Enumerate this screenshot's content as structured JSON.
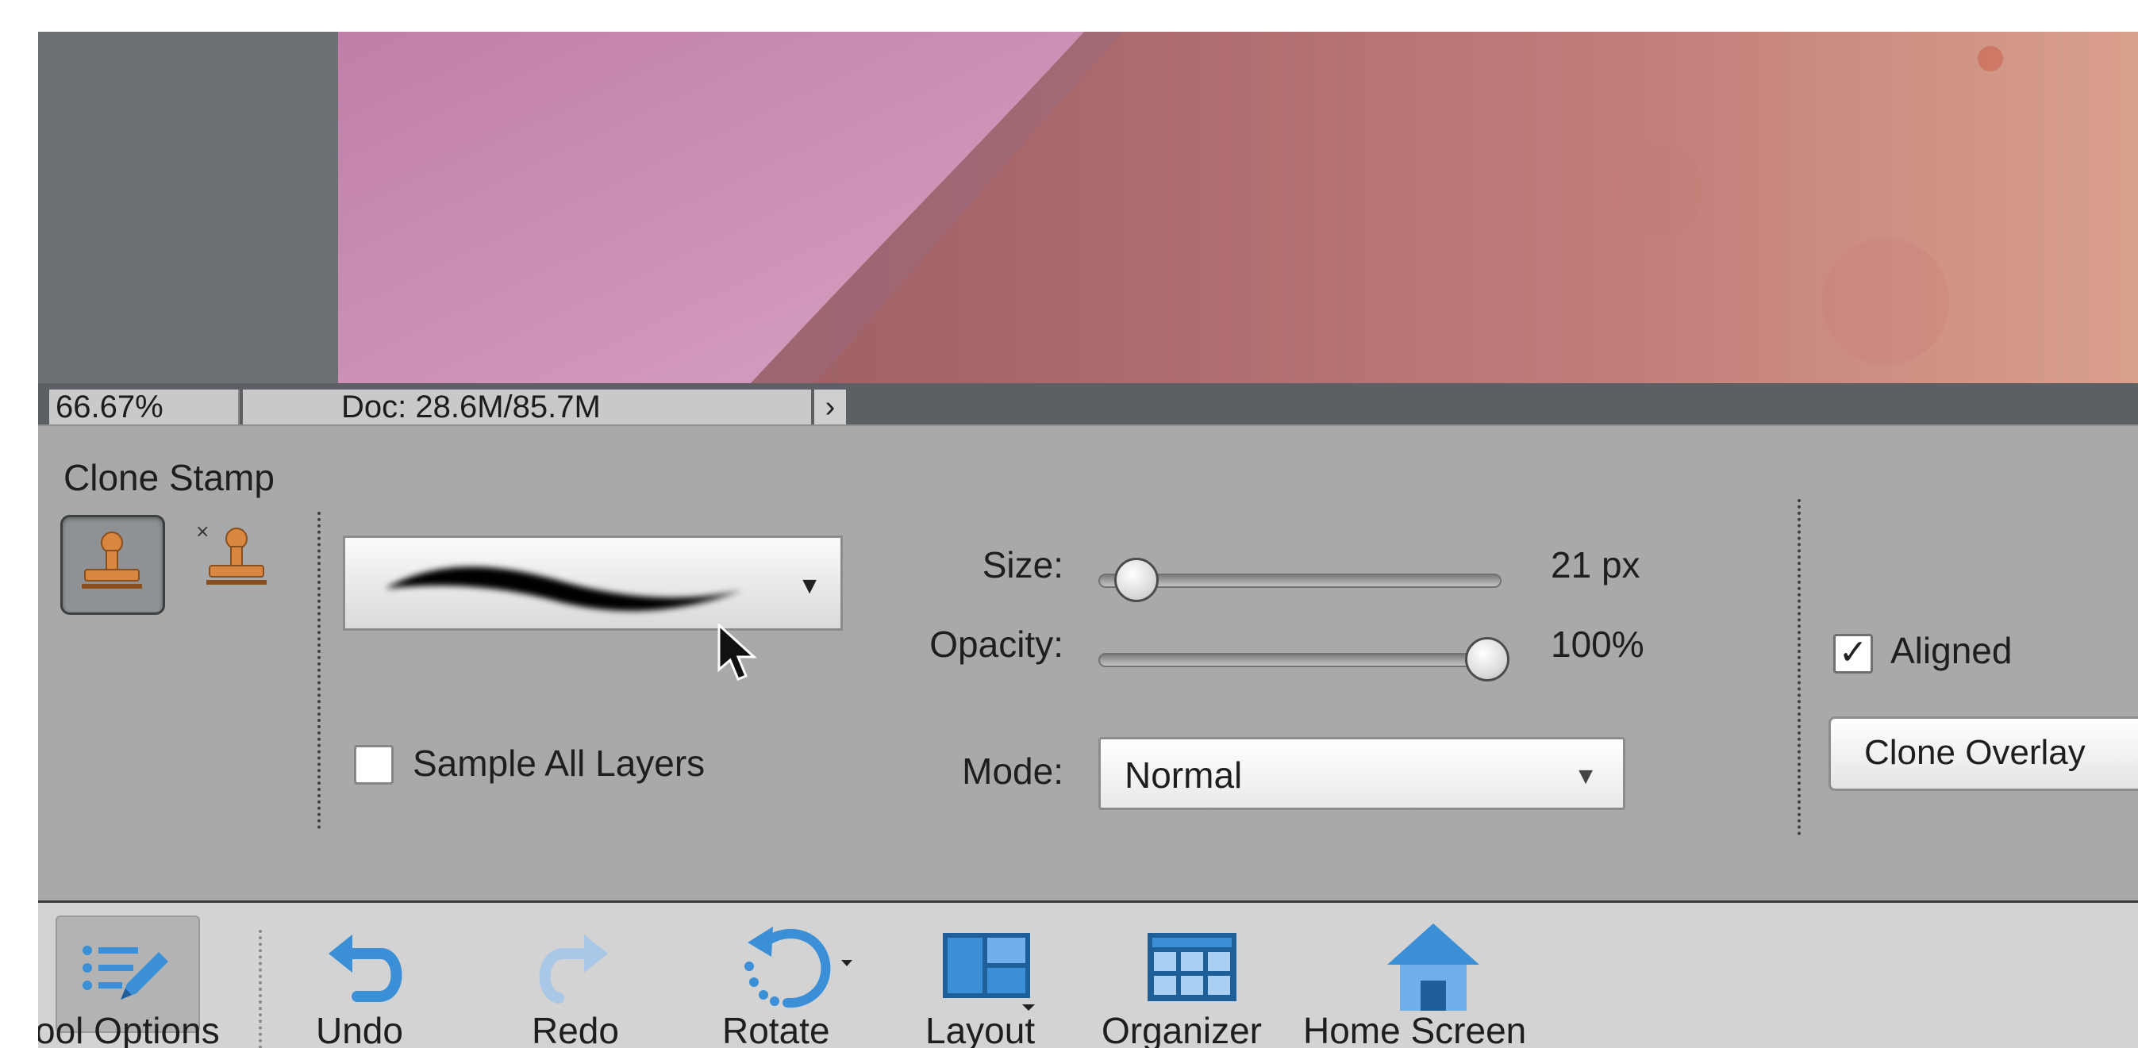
{
  "status": {
    "zoom": "66.67%",
    "doc": "Doc: 28.6M/85.7M",
    "arrow": "›"
  },
  "options": {
    "tool_title": "Clone Stamp",
    "sample_all_layers": "Sample All Layers",
    "size_label": "Size:",
    "size_value": "21 px",
    "size_fraction": 0.08,
    "opacity_label": "Opacity:",
    "opacity_value": "100%",
    "opacity_fraction": 1.0,
    "mode_label": "Mode:",
    "mode_value": "Normal",
    "aligned_label": "Aligned",
    "aligned_checked": true,
    "sample_checked": false,
    "clone_overlay": "Clone Overlay",
    "icons": [
      "clone-stamp-icon",
      "pattern-stamp-icon",
      "brush-stroke-icon",
      "dropdown-caret-icon"
    ]
  },
  "taskbar": {
    "items": [
      {
        "label": "ool Options",
        "icon": "tool-options-icon"
      },
      {
        "label": "Undo",
        "icon": "undo-icon"
      },
      {
        "label": "Redo",
        "icon": "redo-icon"
      },
      {
        "label": "Rotate",
        "icon": "rotate-icon"
      },
      {
        "label": "Layout",
        "icon": "layout-icon"
      },
      {
        "label": "Organizer",
        "icon": "organizer-icon"
      },
      {
        "label": "Home Screen",
        "icon": "home-icon"
      }
    ]
  },
  "colors": {
    "accent_blue": "#3a8fd6",
    "stamp_orange": "#d9873f",
    "panel_gray": "#a7a9aa",
    "canvas_gray": "#6d7175"
  }
}
